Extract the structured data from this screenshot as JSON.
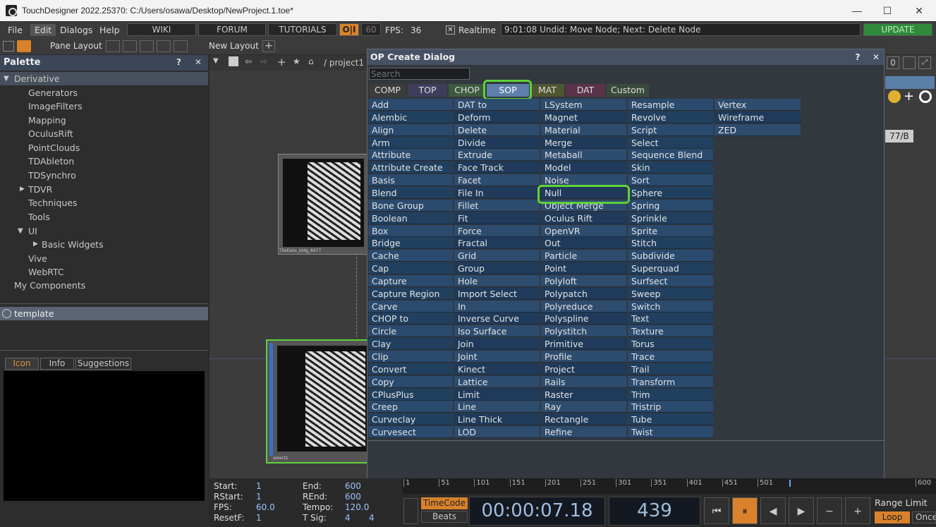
{
  "titlebar": {
    "title": "TouchDesigner 2022.25370: C:/Users/osawa/Desktop/NewProject.1.toe*",
    "min": "—",
    "max": "☐",
    "close": "✕"
  },
  "menubar": {
    "items": [
      "File",
      "Edit",
      "Dialogs",
      "Help"
    ],
    "wiki": "WIKI",
    "forum": "FORUM",
    "tutorials": "TUTORIALS",
    "oi": "O|I",
    "fps_cap": "60",
    "fps_label": "FPS:",
    "fps_value": "36",
    "realtime_check": "✕",
    "realtime": "Realtime",
    "status": "9:01:08 Undid: Move Node; Next: Delete Node",
    "update": "UPDATE"
  },
  "toolbar2": {
    "pane_layout": "Pane Layout",
    "new_layout": "New Layout",
    "plus": "+"
  },
  "palette": {
    "title": "Palette",
    "help": "?",
    "close": "✕",
    "root": "Derivative",
    "items": [
      "Generators",
      "ImageFilters",
      "Mapping",
      "OculusRift",
      "PointClouds",
      "TDAbleton",
      "TDSynchro",
      "TDVR",
      "Techniques",
      "Tools",
      "UI",
      "Basic Widgets",
      "Vive",
      "WebRTC",
      "My Components"
    ],
    "template": "template",
    "tabs": [
      "Icon",
      "Info",
      "Suggestions"
    ]
  },
  "network": {
    "path": "/ project1",
    "node1_label": "TileData_bldg_6677",
    "node2_label": "select1",
    "right_value": "0",
    "right_label": "77/B"
  },
  "dialog": {
    "title": "OP Create Dialog",
    "help": "?",
    "close": "✕",
    "search_placeholder": "Search",
    "tabs": [
      "COMP",
      "TOP",
      "CHOP",
      "SOP",
      "MAT",
      "DAT",
      "Custom"
    ],
    "columns": [
      [
        "Add",
        "Alembic",
        "Align",
        "Arm",
        "Attribute",
        "Attribute Create",
        "Basis",
        "Blend",
        "Bone Group",
        "Boolean",
        "Box",
        "Bridge",
        "Cache",
        "Cap",
        "Capture",
        "Capture Region",
        "Carve",
        "CHOP to",
        "Circle",
        "Clay",
        "Clip",
        "Convert",
        "Copy",
        "CPlusPlus",
        "Creep",
        "Curveclay",
        "Curvesect"
      ],
      [
        "DAT to",
        "Deform",
        "Delete",
        "Divide",
        "Extrude",
        "Face Track",
        "Facet",
        "File In",
        "Fillet",
        "Fit",
        "Force",
        "Fractal",
        "Grid",
        "Group",
        "Hole",
        "Import Select",
        "In",
        "Inverse Curve",
        "Iso Surface",
        "Join",
        "Joint",
        "Kinect",
        "Lattice",
        "Limit",
        "Line",
        "Line Thick",
        "LOD"
      ],
      [
        "LSystem",
        "Magnet",
        "Material",
        "Merge",
        "Metaball",
        "Model",
        "Noise",
        "Null",
        "Object Merge",
        "Oculus Rift",
        "OpenVR",
        "Out",
        "Particle",
        "Point",
        "Polyloft",
        "Polypatch",
        "Polyreduce",
        "Polyspline",
        "Polystitch",
        "Primitive",
        "Profile",
        "Project",
        "Rails",
        "Raster",
        "Ray",
        "Rectangle",
        "Refine"
      ],
      [
        "Resample",
        "Revolve",
        "Script",
        "Select",
        "Sequence Blend",
        "Skin",
        "Sort",
        "Sphere",
        "Spring",
        "Sprinkle",
        "Sprite",
        "Stitch",
        "Subdivide",
        "Superquad",
        "Surfsect",
        "Sweep",
        "Switch",
        "Text",
        "Texture",
        "Torus",
        "Trace",
        "Trail",
        "Transform",
        "Trim",
        "Tristrip",
        "Tube",
        "Twist"
      ],
      [
        "Vertex",
        "Wireframe",
        "ZED"
      ]
    ]
  },
  "timeline": {
    "start_label": "Start:",
    "start": "1",
    "end_label": "End:",
    "end": "600",
    "rstart_label": "RStart:",
    "rstart": "1",
    "rend_label": "REnd:",
    "rend": "600",
    "fps_label": "FPS:",
    "fps": "60.0",
    "tempo_label": "Tempo:",
    "tempo": "120.0",
    "resetf_label": "ResetF:",
    "resetf": "1",
    "tsig_label": "T Sig:",
    "tsig_a": "4",
    "tsig_b": "4",
    "ruler": [
      "1",
      "51",
      "101",
      "151",
      "201",
      "251",
      "301",
      "351",
      "401",
      "451",
      "501",
      "600"
    ],
    "timecode_btn": "TimeCode",
    "beats_btn": "Beats",
    "timecode": "00:00:07.18",
    "frame": "439",
    "range_limit": "Range Limit",
    "loop": "Loop",
    "once": "Once"
  },
  "colors": {
    "accent_green": "#5ed23a",
    "dialog_header": "#465263",
    "update_green": "#2e8a3a",
    "orange": "#d9822b"
  }
}
